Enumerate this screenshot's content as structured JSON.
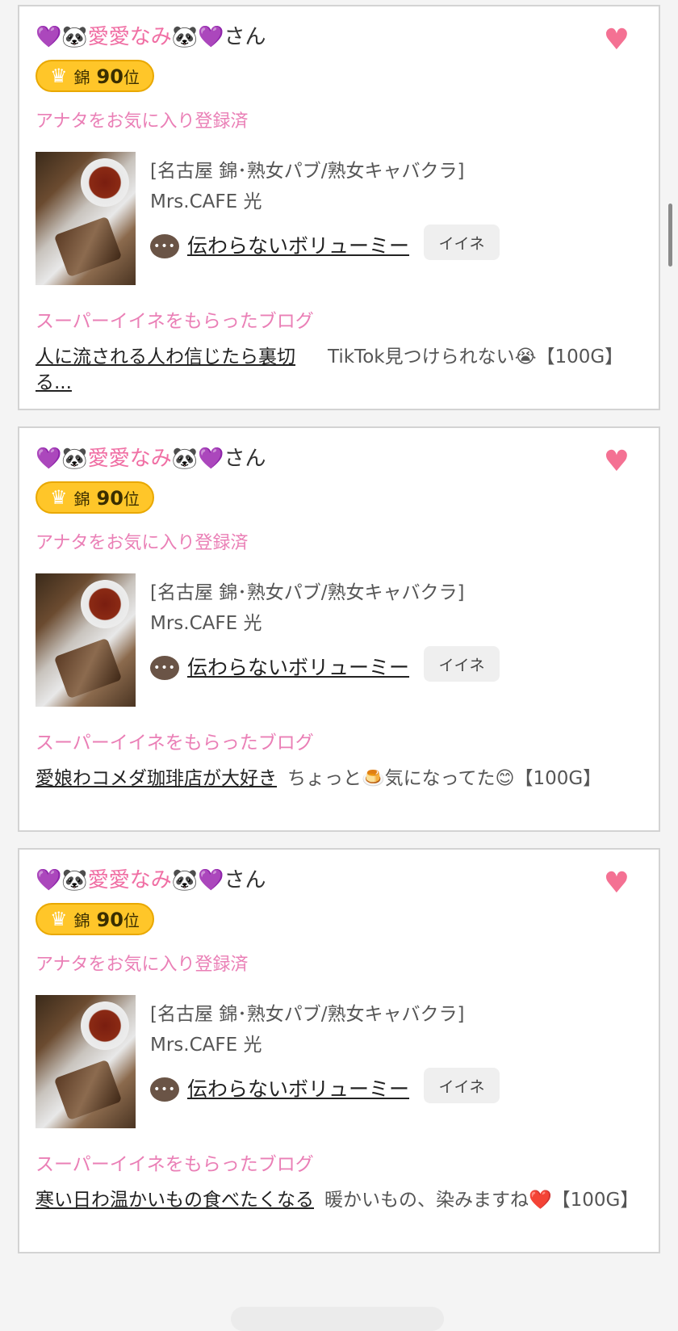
{
  "cards": [
    {
      "user_name_prefix": "💜🐼",
      "user_name_nick": "愛愛なみ",
      "user_name_suffix": "🐼💜",
      "honorific": "さん",
      "rank_area": "錦",
      "rank_number": "90",
      "rank_unit": "位",
      "favorite_note": "アナタをお気に入り登録済",
      "shop_category": "[名古屋 錦･熟女パブ/熟女キャバクラ]",
      "shop_name": "Mrs.CAFE 光",
      "blog_title": "伝わらないボリューミー",
      "iine_label": "イイネ",
      "super_heading": "スーパーイイネをもらったブログ",
      "super_blog_title": "人に流される人わ信じたら裏切る...",
      "super_blog_comment": "TikTok見つけられない😭【100G】"
    },
    {
      "user_name_prefix": "💜🐼",
      "user_name_nick": "愛愛なみ",
      "user_name_suffix": "🐼💜",
      "honorific": "さん",
      "rank_area": "錦",
      "rank_number": "90",
      "rank_unit": "位",
      "favorite_note": "アナタをお気に入り登録済",
      "shop_category": "[名古屋 錦･熟女パブ/熟女キャバクラ]",
      "shop_name": "Mrs.CAFE 光",
      "blog_title": "伝わらないボリューミー",
      "iine_label": "イイネ",
      "super_heading": "スーパーイイネをもらったブログ",
      "super_blog_title": "愛娘わコメダ珈琲店が大好き",
      "super_blog_comment": "ちょっと🍮気になってた😊【100G】"
    },
    {
      "user_name_prefix": "💜🐼",
      "user_name_nick": "愛愛なみ",
      "user_name_suffix": "🐼💜",
      "honorific": "さん",
      "rank_area": "錦",
      "rank_number": "90",
      "rank_unit": "位",
      "favorite_note": "アナタをお気に入り登録済",
      "shop_category": "[名古屋 錦･熟女パブ/熟女キャバクラ]",
      "shop_name": "Mrs.CAFE 光",
      "blog_title": "伝わらないボリューミー",
      "iine_label": "イイネ",
      "super_heading": "スーパーイイネをもらったブログ",
      "super_blog_title": "寒い日わ温かいもの食べたくなる",
      "super_blog_comment": "暖かいもの、染みますね❤️【100G】"
    }
  ],
  "icons": {
    "heart": "heart-icon",
    "crown": "crown-icon",
    "chat": "chat-bubble-icon"
  },
  "colors": {
    "accent_pink": "#ea7fb6",
    "heart_pink": "#f47193",
    "badge_gold": "#ffc629"
  }
}
